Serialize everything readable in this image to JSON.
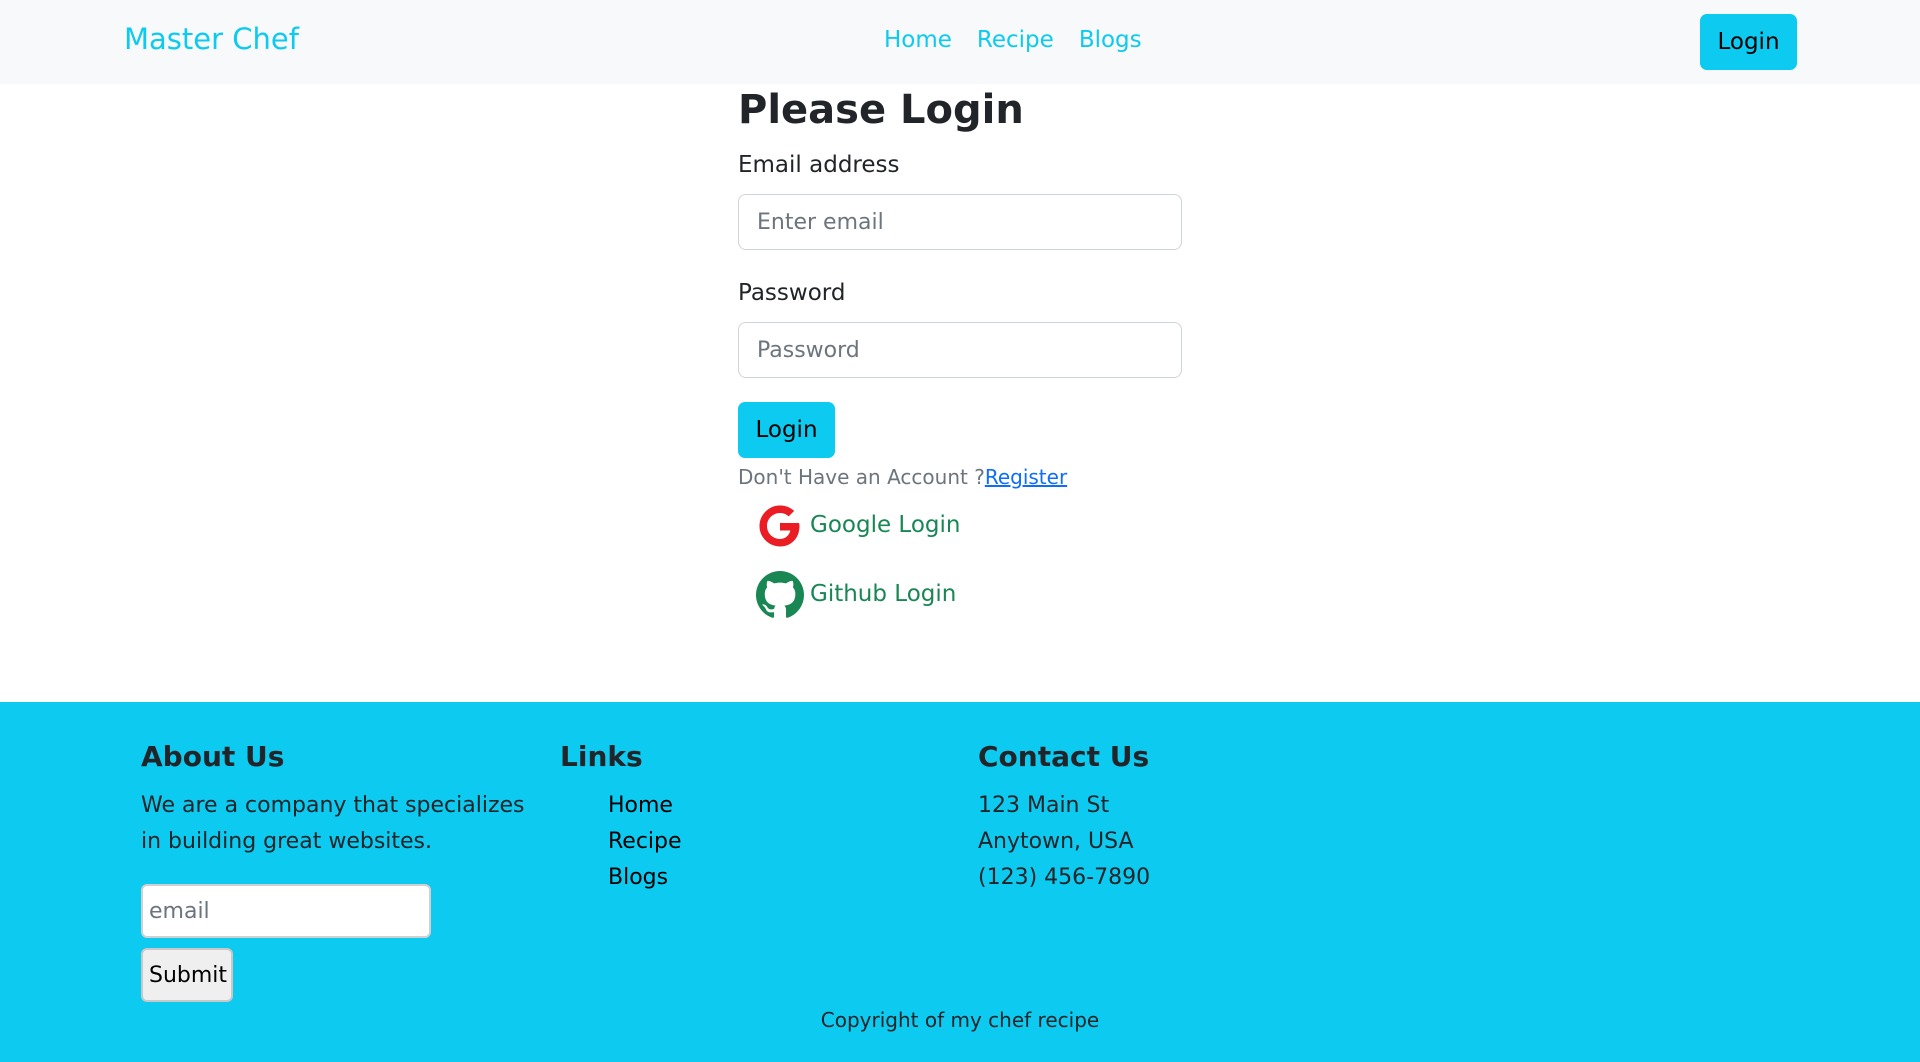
{
  "navbar": {
    "brand": "Master Chef",
    "links": [
      {
        "label": "Home"
      },
      {
        "label": "Recipe"
      },
      {
        "label": "Blogs"
      }
    ],
    "login_label": "Login"
  },
  "login_form": {
    "title": "Please Login",
    "email_label": "Email address",
    "email_placeholder": "Enter email",
    "email_value": "",
    "password_label": "Password",
    "password_placeholder": "Password",
    "password_value": "",
    "submit_label": "Login",
    "account_prompt": "Don't Have an Account ?",
    "register_label": "Register",
    "google_label": "Google Login",
    "github_label": "Github Login"
  },
  "footer": {
    "about": {
      "heading": "About Us",
      "text": "We are a company that specializes in building great websites.",
      "email_placeholder": "email",
      "submit_label": "Submit"
    },
    "links": {
      "heading": "Links",
      "items": [
        {
          "label": "Home"
        },
        {
          "label": "Recipe"
        },
        {
          "label": "Blogs"
        }
      ]
    },
    "contact": {
      "heading": "Contact Us",
      "address_line1": "123 Main St",
      "address_line2": "Anytown, USA",
      "phone": "(123) 456-7890"
    },
    "copyright": "Copyright of my chef recipe"
  },
  "colors": {
    "accent": "#0dcaf0",
    "navbar_bg": "#f8f9fa",
    "social_text": "#198754",
    "google_icon": "#ea1c24",
    "github_icon": "#198754",
    "register_link": "#0d6efd"
  },
  "icons": {
    "google": "google-icon",
    "github": "github-icon"
  }
}
